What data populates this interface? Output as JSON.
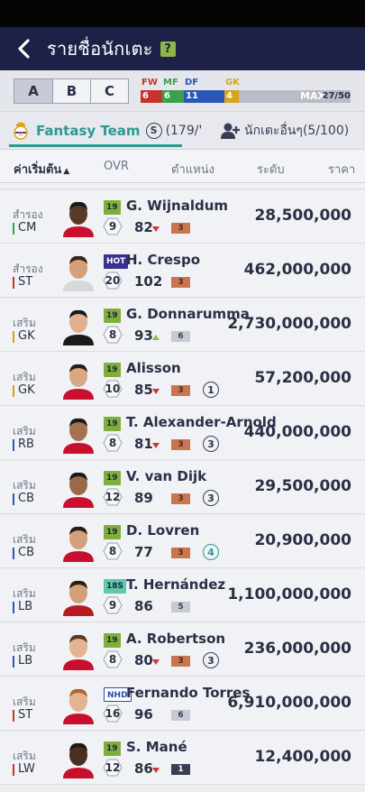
{
  "header": {
    "title": "รายชื่อนักเตะ",
    "help": "?"
  },
  "squads": {
    "tabs": [
      "A",
      "B",
      "C"
    ],
    "active": 0
  },
  "positions": {
    "labels": [
      {
        "key": "fw",
        "label": "FW",
        "color": "#c8322d"
      },
      {
        "key": "mf",
        "label": "MF",
        "color": "#3aa14a"
      },
      {
        "key": "df",
        "label": "DF",
        "color": "#2b57b6"
      },
      {
        "key": "gk",
        "label": "GK",
        "color": "#d9a41a"
      }
    ],
    "counts": {
      "fw": "6",
      "mf": "6",
      "df": "11",
      "gk": "4"
    },
    "max_label": "MAX",
    "capacity": "27/50"
  },
  "team": {
    "name": "Fantasy Team",
    "salary_symbol": "S",
    "salary": "(179/'",
    "other_label": "นักเตะอื่นๆ(5/100)"
  },
  "sort": {
    "default": "ค่าเริ่มต้น",
    "ovr": "OVR",
    "position": "ตำแหน่ง",
    "level": "ระดับ",
    "price": "ราคา"
  },
  "players": [
    {
      "role": "สำรอง",
      "pos": "CM",
      "pos_color": "#3aa14a",
      "season": "19",
      "season_style": "s19",
      "name": "G. Wijnaldum",
      "salary": "9",
      "ovr": "82",
      "trend": "down",
      "level": "3",
      "level_style": "bronze",
      "chem": "",
      "value": "28,500,000",
      "skin": "#5a3a26",
      "kit": "#c8102e",
      "hair": "#1a1a1a"
    },
    {
      "role": "สำรอง",
      "pos": "ST",
      "pos_color": "#c8322d",
      "season": "HOT",
      "season_style": "hot",
      "name": "H. Crespo",
      "salary": "20",
      "ovr": "102",
      "trend": "",
      "level": "3",
      "level_style": "bronze",
      "chem": "",
      "value": "462,000,000",
      "skin": "#d4a07a",
      "kit": "#d8d8d8",
      "hair": "#3a2516"
    },
    {
      "role": "เสริม",
      "pos": "GK",
      "pos_color": "#d9a41a",
      "season": "19",
      "season_style": "s19",
      "name": "G. Donnarumma",
      "salary": "8",
      "ovr": "93",
      "trend": "up",
      "level": "6",
      "level_style": "silver",
      "chem": "",
      "value": "2,730,000,000",
      "skin": "#e0b090",
      "kit": "#1a1a1a",
      "hair": "#1a1a1a"
    },
    {
      "role": "เสริม",
      "pos": "GK",
      "pos_color": "#d9a41a",
      "season": "19",
      "season_style": "s19",
      "name": "Alisson",
      "salary": "10",
      "ovr": "85",
      "trend": "down",
      "level": "3",
      "level_style": "bronze",
      "chem": "1",
      "value": "57,200,000",
      "skin": "#d9a882",
      "kit": "#c8102e",
      "hair": "#2a1c12"
    },
    {
      "role": "เสริม",
      "pos": "RB",
      "pos_color": "#2b57b6",
      "season": "19",
      "season_style": "s19",
      "name": "T. Alexander-Arnold",
      "salary": "8",
      "ovr": "81",
      "trend": "down",
      "level": "3",
      "level_style": "bronze",
      "chem": "3",
      "value": "440,000,000",
      "skin": "#a57350",
      "kit": "#c8102e",
      "hair": "#1a1a1a"
    },
    {
      "role": "เสริม",
      "pos": "CB",
      "pos_color": "#2b57b6",
      "season": "19",
      "season_style": "s19",
      "name": "V. van Dijk",
      "salary": "12",
      "ovr": "89",
      "trend": "",
      "level": "3",
      "level_style": "bronze",
      "chem": "3",
      "value": "29,500,000",
      "skin": "#9a6a48",
      "kit": "#c8102e",
      "hair": "#1a1a1a"
    },
    {
      "role": "เสริม",
      "pos": "CB",
      "pos_color": "#2b57b6",
      "season": "19",
      "season_style": "s19",
      "name": "D. Lovren",
      "salary": "8",
      "ovr": "77",
      "trend": "",
      "level": "3",
      "level_style": "bronze",
      "chem": "4",
      "value": "20,900,000",
      "skin": "#d4a07a",
      "kit": "#c8102e",
      "hair": "#2a1c12"
    },
    {
      "role": "เสริม",
      "pos": "LB",
      "pos_color": "#2b57b6",
      "season": "18S",
      "season_style": "s18",
      "name": "T. Hernández",
      "salary": "9",
      "ovr": "86",
      "trend": "",
      "level": "5",
      "level_style": "silver",
      "chem": "",
      "value": "1,100,000,000",
      "skin": "#d4a07a",
      "kit": "#b81c22",
      "hair": "#2a1c12"
    },
    {
      "role": "เสริม",
      "pos": "LB",
      "pos_color": "#2b57b6",
      "season": "19",
      "season_style": "s19",
      "name": "A. Robertson",
      "salary": "8",
      "ovr": "80",
      "trend": "down",
      "level": "3",
      "level_style": "bronze",
      "chem": "3",
      "value": "236,000,000",
      "skin": "#e2b494",
      "kit": "#c8102e",
      "hair": "#5a3a1c"
    },
    {
      "role": "เสริม",
      "pos": "ST",
      "pos_color": "#c8322d",
      "season": "NHD",
      "season_style": "nhd",
      "name": "Fernando Torres",
      "salary": "16",
      "ovr": "96",
      "trend": "",
      "level": "6",
      "level_style": "silver",
      "chem": "",
      "value": "6,910,000,000",
      "skin": "#e2b494",
      "kit": "#c8102e",
      "hair": "#b0652a"
    },
    {
      "role": "เสริม",
      "pos": "LW",
      "pos_color": "#c8322d",
      "season": "19",
      "season_style": "s19",
      "name": "S. Mané",
      "salary": "12",
      "ovr": "86",
      "trend": "down",
      "level": "1",
      "level_style": "dark",
      "chem": "",
      "value": "12,400,000",
      "skin": "#4a2e1e",
      "kit": "#c8102e",
      "hair": "#1a1a1a"
    }
  ]
}
